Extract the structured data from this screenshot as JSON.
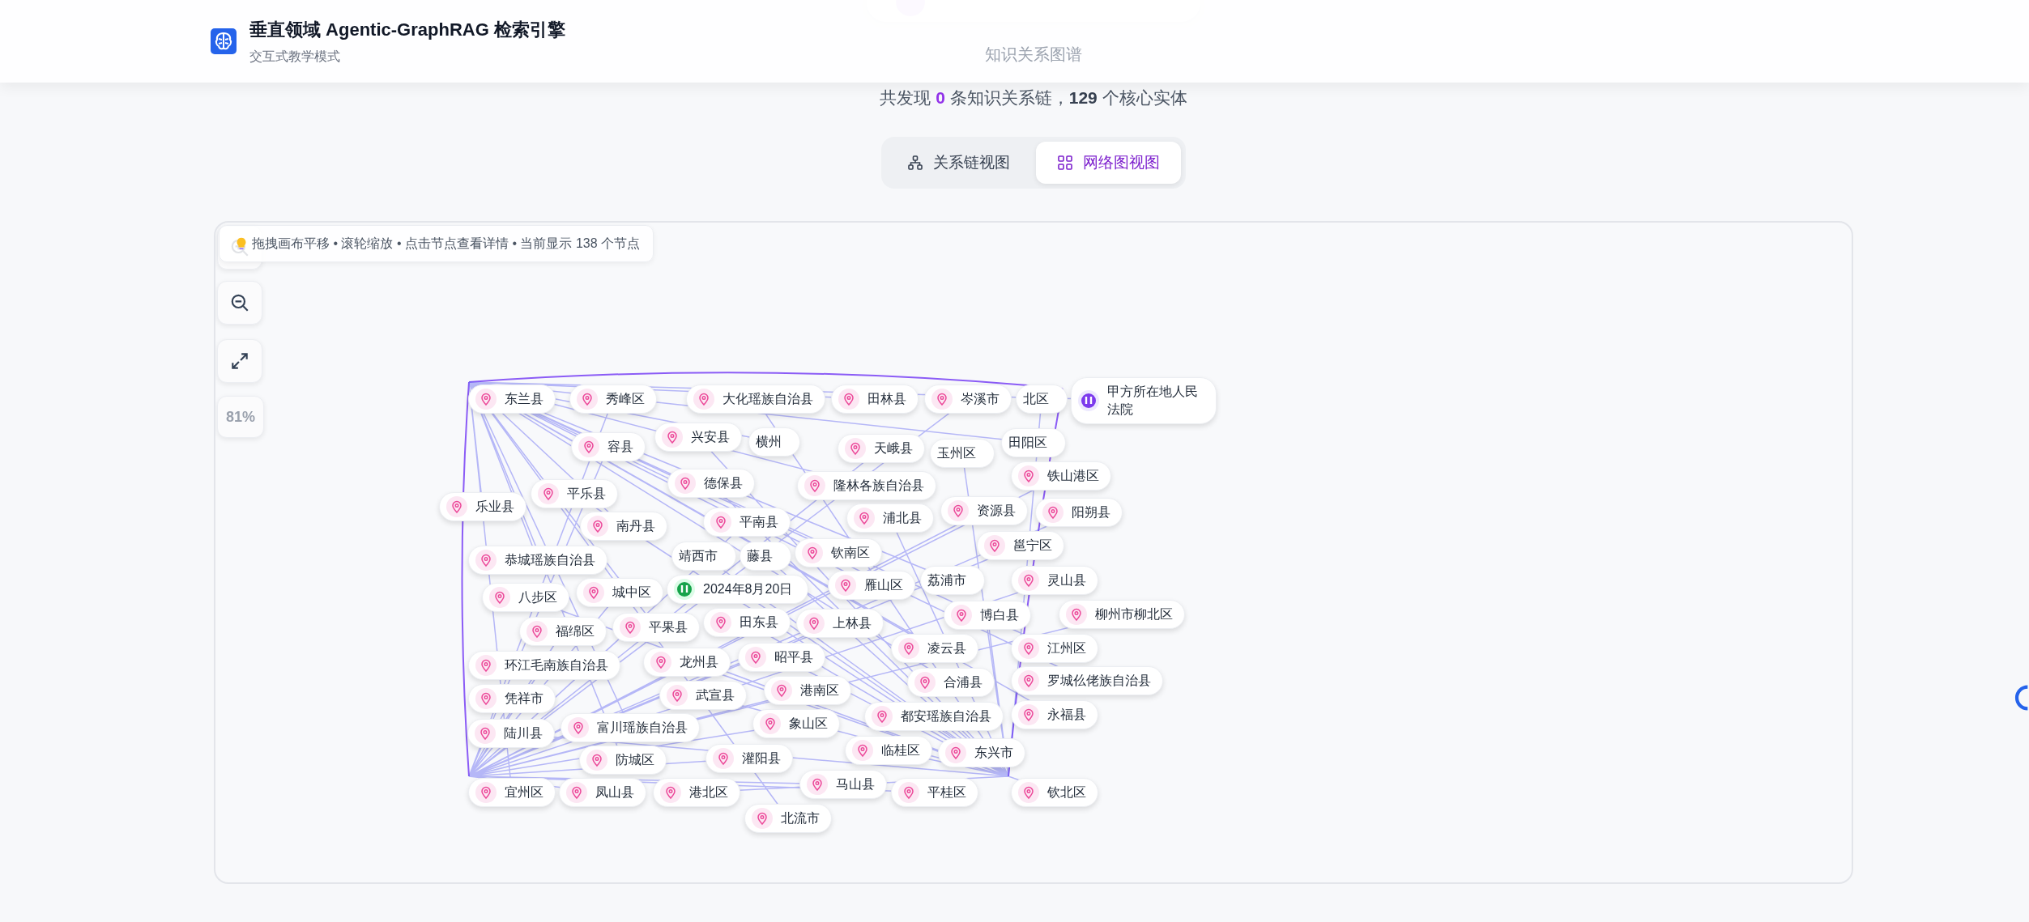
{
  "header": {
    "title": "垂直领域 Agentic-GraphRAG 检索引擎",
    "subtitle": "交互式教学模式"
  },
  "section_title": "知识关系图谱",
  "summary": {
    "prefix": "共发现",
    "chains": "0",
    "middle": "条知识关系链，",
    "entities": "129",
    "suffix": "个核心实体"
  },
  "views": [
    {
      "label": "关系链视图",
      "kind": "chain",
      "selected": false
    },
    {
      "label": "网络图视图",
      "kind": "network",
      "selected": true
    }
  ],
  "canvas": {
    "hint": "拖拽画布平移 • 滚轮缩放 • 点击节点查看详情 • 当前显示 138 个节点",
    "zoom_level": "81%",
    "nodes": [
      {
        "label": "东兰县",
        "kind": "place"
      },
      {
        "label": "秀峰区",
        "kind": "place"
      },
      {
        "label": "大化瑶族自治县",
        "kind": "place"
      },
      {
        "label": "田林县",
        "kind": "place"
      },
      {
        "label": "岑溪市",
        "kind": "place"
      },
      {
        "label": "北区",
        "kind": "plain"
      },
      {
        "label": "甲方所在地人民法院",
        "kind": "org"
      },
      {
        "label": "容县",
        "kind": "place"
      },
      {
        "label": "兴安县",
        "kind": "place"
      },
      {
        "label": "横州",
        "kind": "plain"
      },
      {
        "label": "天峨县",
        "kind": "place"
      },
      {
        "label": "玉州区",
        "kind": "plain"
      },
      {
        "label": "田阳区",
        "kind": "plain"
      },
      {
        "label": "铁山港区",
        "kind": "place"
      },
      {
        "label": "德保县",
        "kind": "place"
      },
      {
        "label": "隆林各族自治县",
        "kind": "place"
      },
      {
        "label": "资源县",
        "kind": "place"
      },
      {
        "label": "平乐县",
        "kind": "place"
      },
      {
        "label": "乐业县",
        "kind": "place"
      },
      {
        "label": "阳朔县",
        "kind": "place"
      },
      {
        "label": "浦北县",
        "kind": "place"
      },
      {
        "label": "南丹县",
        "kind": "place"
      },
      {
        "label": "平南县",
        "kind": "place"
      },
      {
        "label": "靖西市",
        "kind": "plain"
      },
      {
        "label": "钦南区",
        "kind": "place"
      },
      {
        "label": "邕宁区",
        "kind": "place"
      },
      {
        "label": "2024年8月20日",
        "kind": "event"
      },
      {
        "label": "恭城瑶族自治县",
        "kind": "place"
      },
      {
        "label": "灵山县",
        "kind": "place"
      },
      {
        "label": "藤县",
        "kind": "plain"
      },
      {
        "label": "雁山区",
        "kind": "place"
      },
      {
        "label": "城中区",
        "kind": "place"
      },
      {
        "label": "田东县",
        "kind": "place"
      },
      {
        "label": "荔浦市",
        "kind": "plain"
      },
      {
        "label": "柳州市柳北区",
        "kind": "place"
      },
      {
        "label": "八步区",
        "kind": "place"
      },
      {
        "label": "平果县",
        "kind": "place"
      },
      {
        "label": "上林县",
        "kind": "place"
      },
      {
        "label": "博白县",
        "kind": "place"
      },
      {
        "label": "凌云县",
        "kind": "place"
      },
      {
        "label": "福绵区",
        "kind": "place"
      },
      {
        "label": "昭平县",
        "kind": "place"
      },
      {
        "label": "江州区",
        "kind": "place"
      },
      {
        "label": "环江毛南族自治县",
        "kind": "place"
      },
      {
        "label": "龙州县",
        "kind": "place"
      },
      {
        "label": "合浦县",
        "kind": "place"
      },
      {
        "label": "港南区",
        "kind": "place"
      },
      {
        "label": "都安瑶族自治县",
        "kind": "place"
      },
      {
        "label": "罗城仫佬族自治县",
        "kind": "place"
      },
      {
        "label": "凭祥市",
        "kind": "place"
      },
      {
        "label": "武宣县",
        "kind": "place"
      },
      {
        "label": "富川瑶族自治县",
        "kind": "place"
      },
      {
        "label": "象山区",
        "kind": "place"
      },
      {
        "label": "陆川县",
        "kind": "place"
      },
      {
        "label": "防城区",
        "kind": "place"
      },
      {
        "label": "灌阳县",
        "kind": "place"
      },
      {
        "label": "临桂区",
        "kind": "place"
      },
      {
        "label": "永福县",
        "kind": "place"
      },
      {
        "label": "马山县",
        "kind": "place"
      },
      {
        "label": "东兴市",
        "kind": "place"
      },
      {
        "label": "宜州区",
        "kind": "place"
      },
      {
        "label": "凤山县",
        "kind": "place"
      },
      {
        "label": "港北区",
        "kind": "place"
      },
      {
        "label": "北流市",
        "kind": "place"
      },
      {
        "label": "平桂区",
        "kind": "place"
      },
      {
        "label": "钦北区",
        "kind": "place"
      }
    ]
  }
}
